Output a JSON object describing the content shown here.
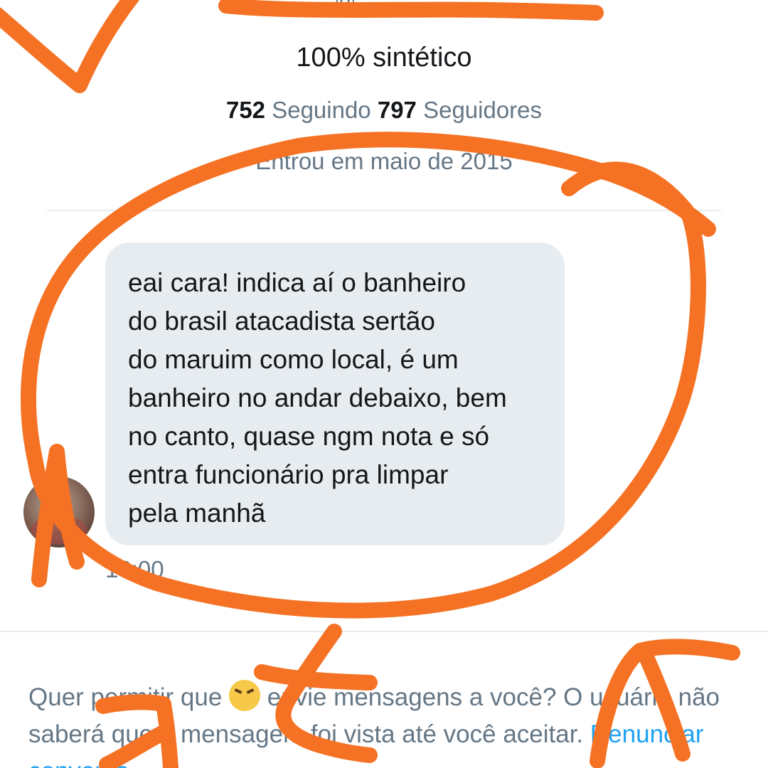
{
  "profile": {
    "handle_partial": "@",
    "bio": "100% sintético",
    "following_count": "752",
    "following_label": "Seguindo",
    "followers_count": "797",
    "followers_label": "Seguidores",
    "joined": "Entrou em maio de 2015"
  },
  "message": {
    "lines": [
      "eai cara! indica aí o banheiro",
      "do brasil atacadista sertão",
      "do maruim como local, é um",
      "banheiro no andar debaixo, bem",
      "no canto, quase ngm nota e só",
      "entra funcionário pra limpar",
      "pela manhã"
    ],
    "time": "16:00"
  },
  "request": {
    "text_before": "Quer permitir que ",
    "text_after": " envie mensagens a você? O usuário não saberá que a mensagem foi vista até você aceitar. ",
    "report_link": "Denunciar conversa",
    "emoji_icon": "tired-face-emoji"
  },
  "colors": {
    "scribble": "#f57224",
    "link": "#1da1f2",
    "muted": "#657786",
    "bubble": "#e6ecf0"
  }
}
